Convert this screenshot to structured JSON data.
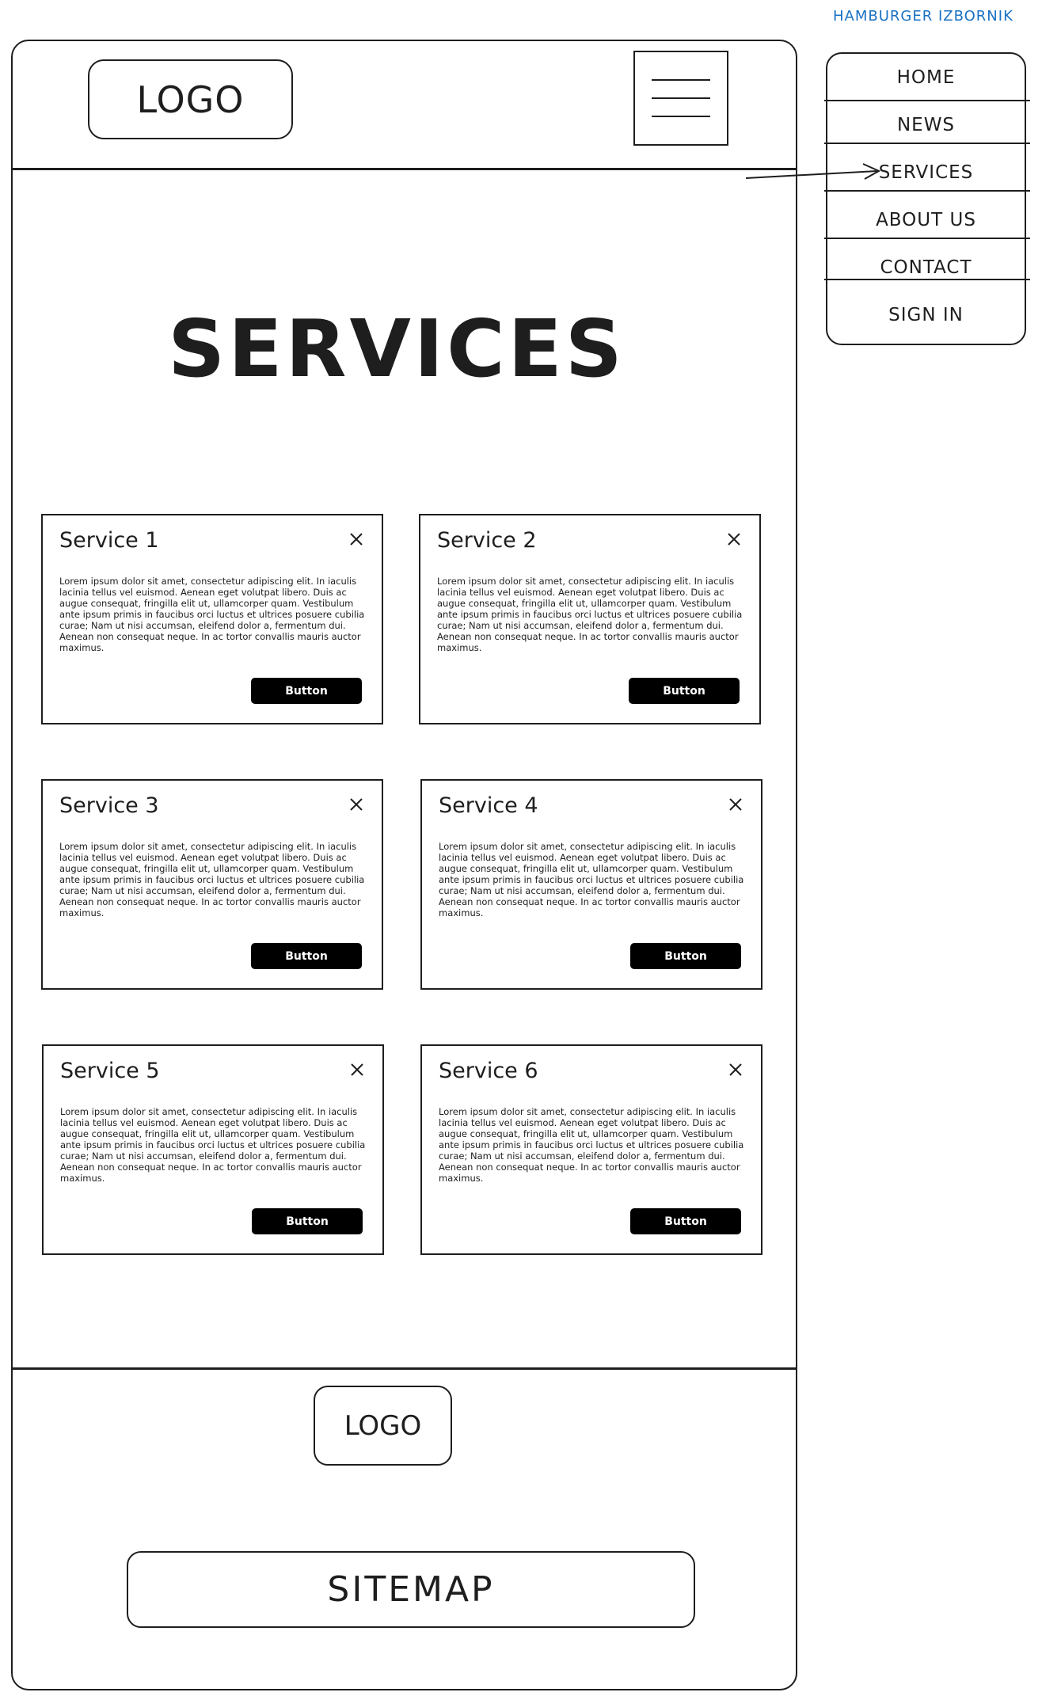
{
  "menu_caption": "HAMBURGER IZBORNIK",
  "menu_items": [
    {
      "label": "HOME"
    },
    {
      "label": "NEWS"
    },
    {
      "label": "SERVICES"
    },
    {
      "label": "ABOUT US"
    },
    {
      "label": "CONTACT"
    },
    {
      "label": "SIGN IN"
    }
  ],
  "header": {
    "logo": "LOGO",
    "menu_icon": "hamburger-icon"
  },
  "page_title": "SERVICES",
  "services": [
    {
      "title": "Service 1",
      "body": "Lorem ipsum dolor sit amet, consectetur adipiscing elit. In iaculis lacinia tellus vel euismod. Aenean eget volutpat libero. Duis ac augue consequat, fringilla elit ut, ullamcorper quam. Vestibulum ante ipsum primis in faucibus orci luctus et ultrices posuere cubilia curae; Nam ut nisi accumsan, eleifend dolor a, fermentum dui. Aenean non consequat neque. In ac tortor convallis mauris auctor maximus.",
      "button": "Button"
    },
    {
      "title": "Service 2",
      "body": "Lorem ipsum dolor sit amet, consectetur adipiscing elit. In iaculis lacinia tellus vel euismod. Aenean eget volutpat libero. Duis ac augue consequat, fringilla elit ut, ullamcorper quam. Vestibulum ante ipsum primis in faucibus orci luctus et ultrices posuere cubilia curae; Nam ut nisi accumsan, eleifend dolor a, fermentum dui. Aenean non consequat neque. In ac tortor convallis mauris auctor maximus.",
      "button": "Button"
    },
    {
      "title": "Service 3",
      "body": "Lorem ipsum dolor sit amet, consectetur adipiscing elit. In iaculis lacinia tellus vel euismod. Aenean eget volutpat libero. Duis ac augue consequat, fringilla elit ut, ullamcorper quam. Vestibulum ante ipsum primis in faucibus orci luctus et ultrices posuere cubilia curae; Nam ut nisi accumsan, eleifend dolor a, fermentum dui. Aenean non consequat neque. In ac tortor convallis mauris auctor maximus.",
      "button": "Button"
    },
    {
      "title": "Service 4",
      "body": "Lorem ipsum dolor sit amet, consectetur adipiscing elit. In iaculis lacinia tellus vel euismod. Aenean eget volutpat libero. Duis ac augue consequat, fringilla elit ut, ullamcorper quam. Vestibulum ante ipsum primis in faucibus orci luctus et ultrices posuere cubilia curae; Nam ut nisi accumsan, eleifend dolor a, fermentum dui. Aenean non consequat neque. In ac tortor convallis mauris auctor maximus.",
      "button": "Button"
    },
    {
      "title": "Service 5",
      "body": "Lorem ipsum dolor sit amet, consectetur adipiscing elit. In iaculis lacinia tellus vel euismod. Aenean eget volutpat libero. Duis ac augue consequat, fringilla elit ut, ullamcorper quam. Vestibulum ante ipsum primis in faucibus orci luctus et ultrices posuere cubilia curae; Nam ut nisi accumsan, eleifend dolor a, fermentum dui. Aenean non consequat neque. In ac tortor convallis mauris auctor maximus.",
      "button": "Button"
    },
    {
      "title": "Service 6",
      "body": "Lorem ipsum dolor sit amet, consectetur adipiscing elit. In iaculis lacinia tellus vel euismod. Aenean eget volutpat libero. Duis ac augue consequat, fringilla elit ut, ullamcorper quam. Vestibulum ante ipsum primis in faucibus orci luctus et ultrices posuere cubilia curae; Nam ut nisi accumsan, eleifend dolor a, fermentum dui. Aenean non consequat neque. In ac tortor convallis mauris auctor maximus.",
      "button": "Button"
    }
  ],
  "footer": {
    "logo": "LOGO",
    "sitemap": "SITEMAP"
  },
  "colors": {
    "stroke": "#1e1e1e",
    "caption": "#1971c2",
    "button_bg": "#000000",
    "button_text": "#ffffff"
  },
  "icons": {
    "close": "close-icon",
    "arrow": "arrow-icon"
  }
}
